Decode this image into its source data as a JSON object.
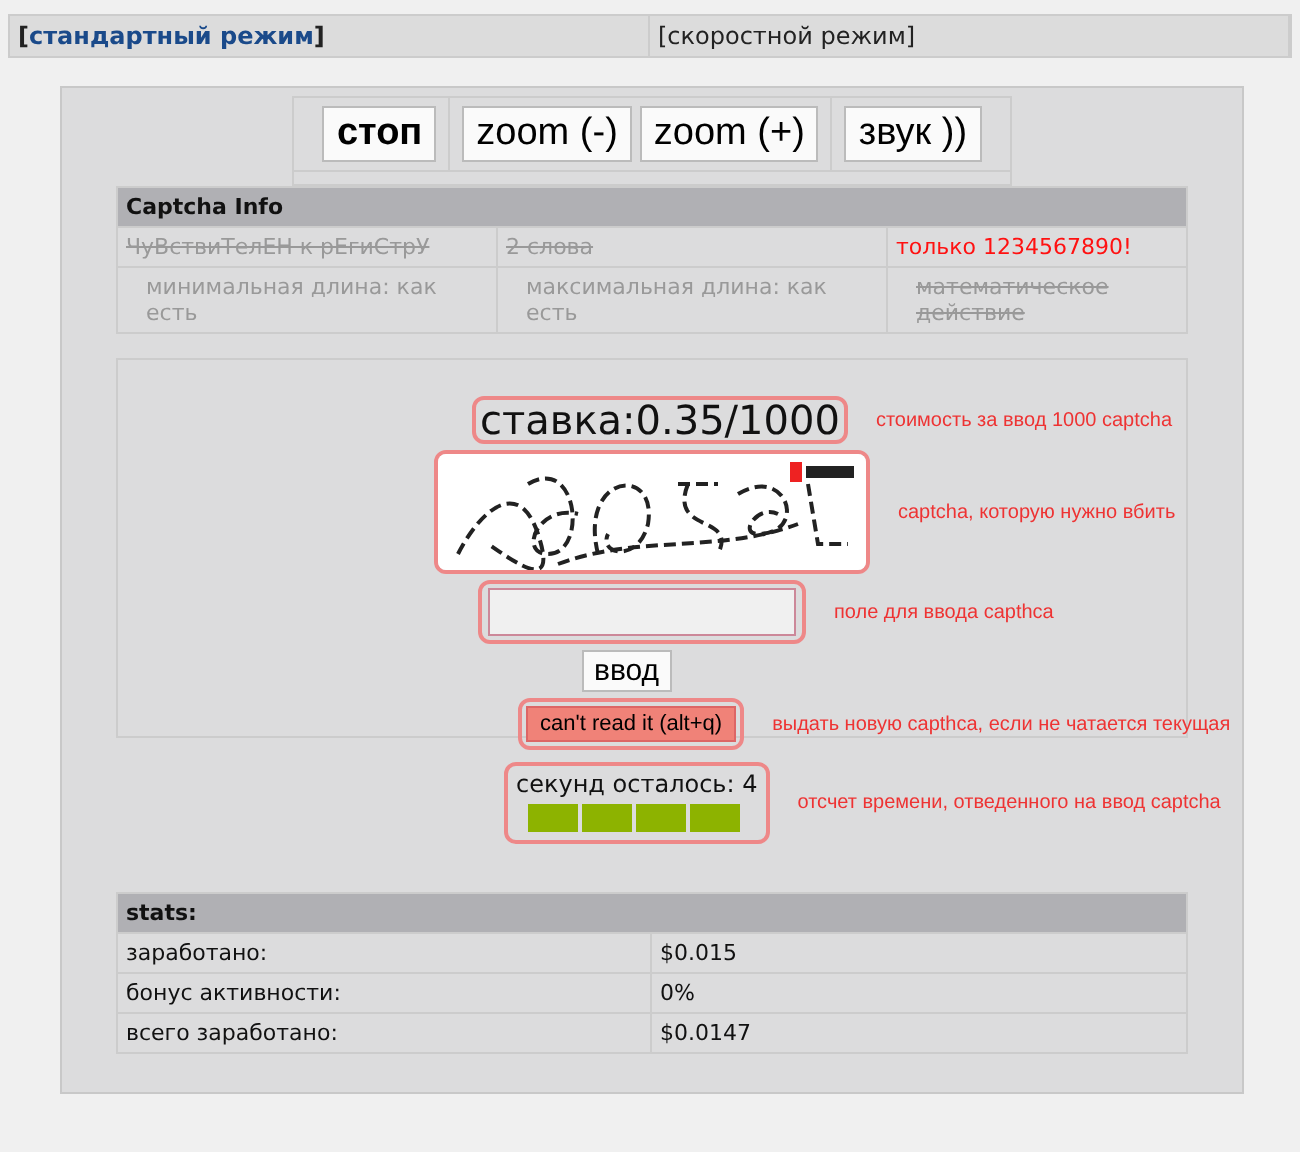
{
  "tabs": [
    {
      "label": "[**стандартный режим**]",
      "selected": true
    },
    {
      "label": "[скоростной режим]",
      "selected": false
    }
  ],
  "toolbar": [
    [
      "стоп"
    ],
    [
      "zoom (-)",
      "zoom (+)"
    ],
    [
      "звук ))"
    ]
  ],
  "captcha_info": {
    "title": "Captcha Info",
    "rows": [
      [
        {
          "text": "ЧуВствиТелЕН к рЕгиСтрУ",
          "kind": "struck"
        },
        {
          "text": "2 слова",
          "kind": "struck"
        },
        {
          "text": "только 1234567890!",
          "kind": "alert"
        }
      ],
      [
        {
          "text": "минимальная длина: как есть",
          "kind": "dim"
        },
        {
          "text": "максимальная длина: как есть",
          "kind": "dim"
        },
        {
          "text": "математическое действие",
          "kind": "struck"
        }
      ]
    ]
  },
  "captcha": {
    "rate": "ставка:0.35/1000",
    "rate_note": "стоимость за ввод 1000 captcha",
    "image_note": "captcha, которую нужно вбить",
    "input_note": "поле для ввода capthca",
    "submit": "ввод",
    "skip": "can't read it (alt+q)",
    "skip_note": "выдать новую capthca, если не чатается текущая"
  },
  "timer": {
    "label": "секунд осталось: 4",
    "level": 1,
    "note": "отсчет времени, отведенного на ввод captcha"
  },
  "stats": {
    "title": "stats:",
    "rows": [
      [
        "заработано:",
        "$0.015"
      ],
      [
        "бонус активности:",
        "0%"
      ],
      [
        "всего заработано:",
        "$0.0147"
      ]
    ]
  }
}
